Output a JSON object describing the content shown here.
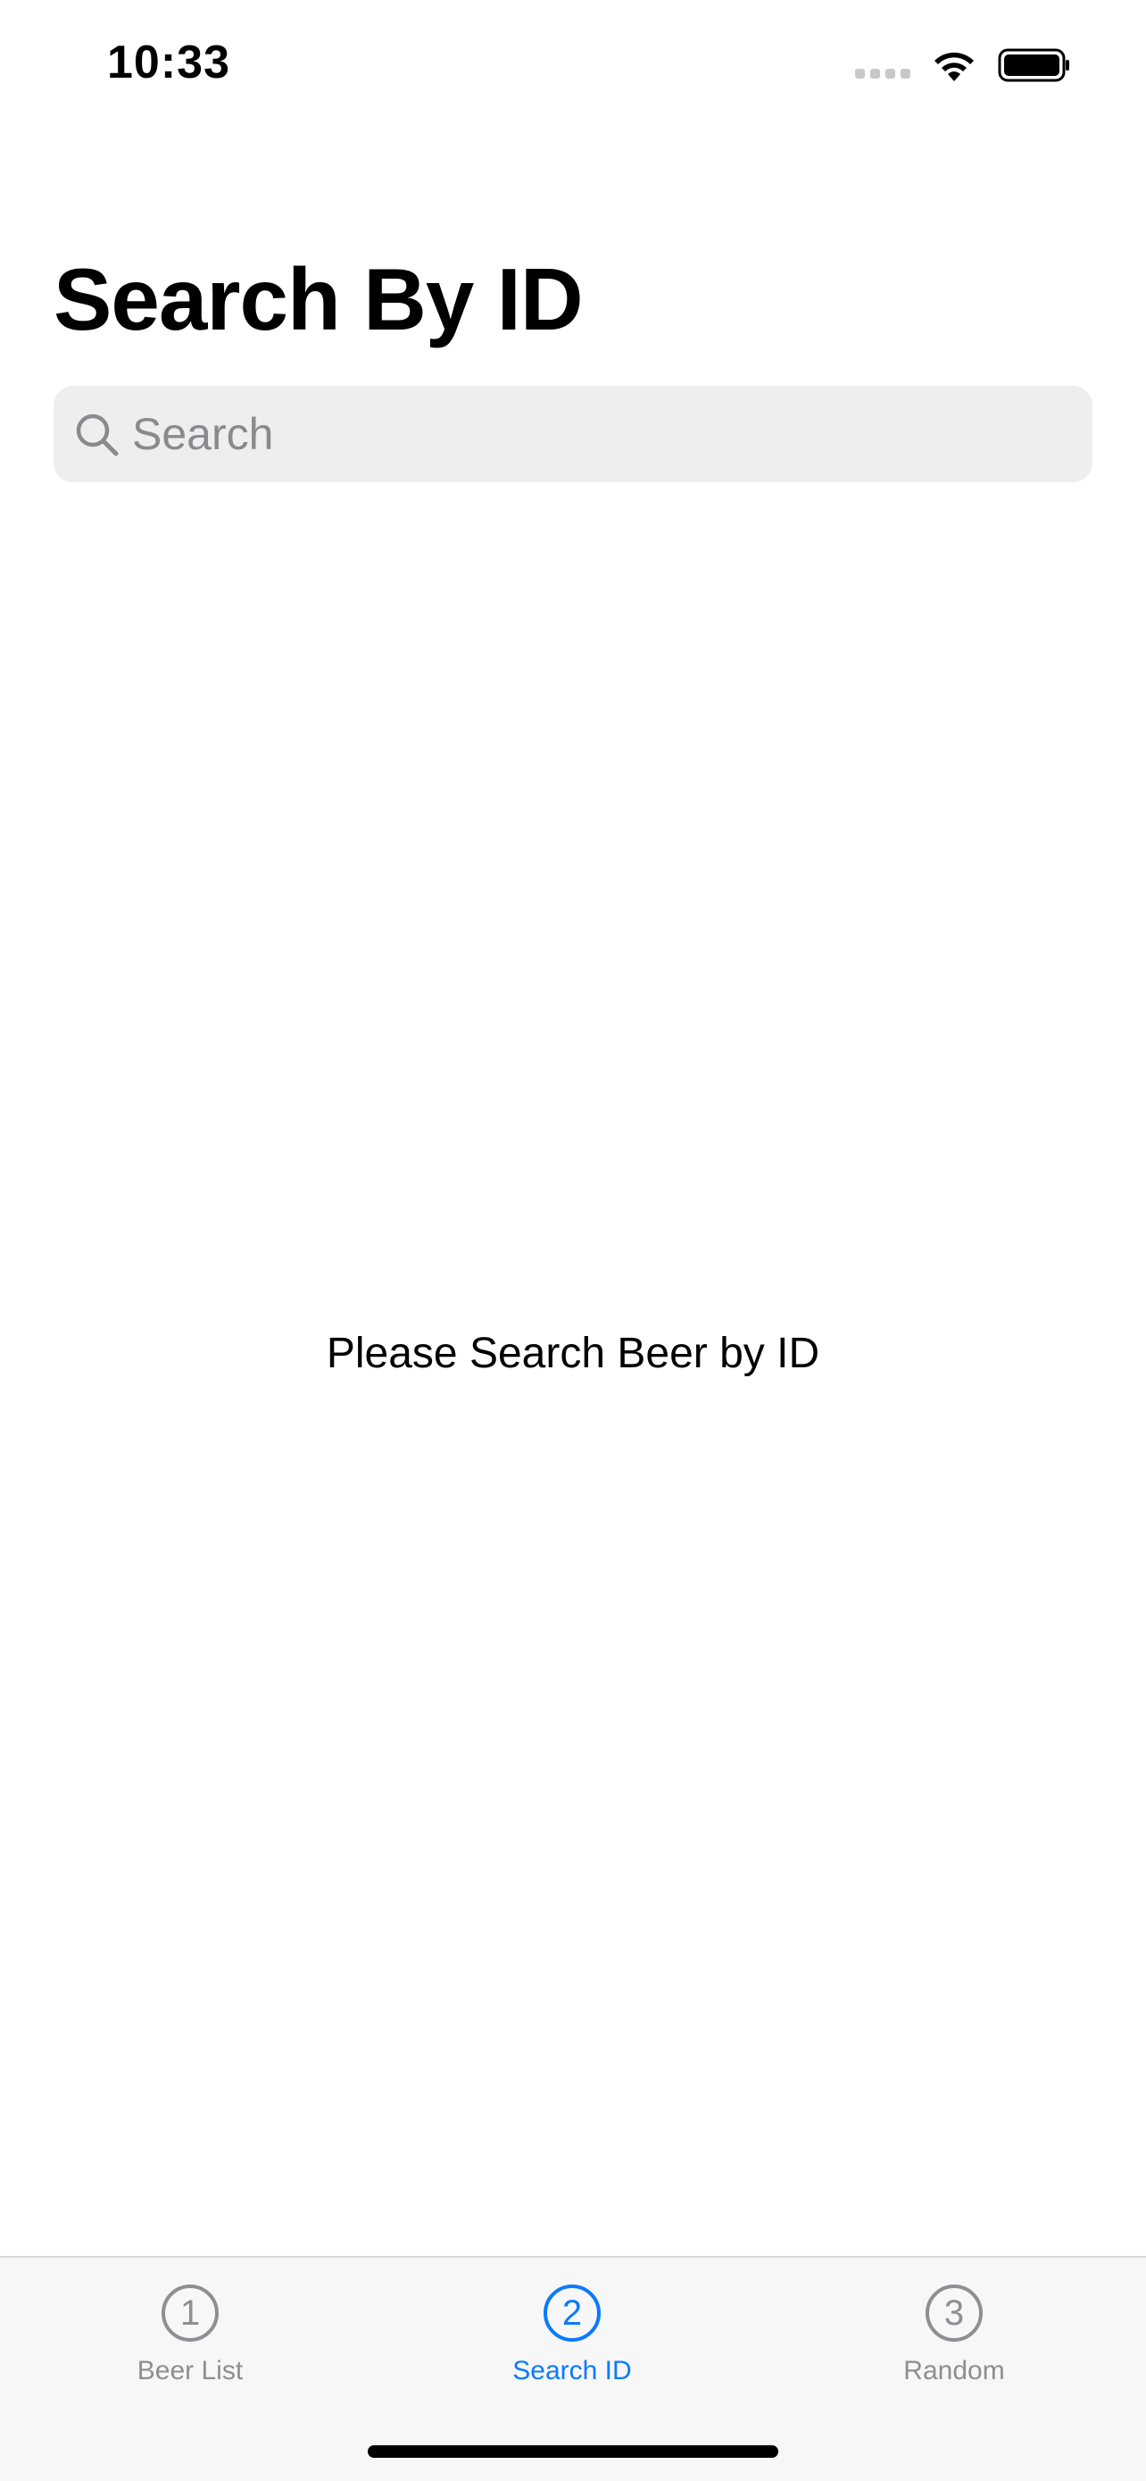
{
  "status_bar": {
    "time": "10:33",
    "wifi_icon": "wifi-icon",
    "battery_icon": "battery-icon",
    "signal_icon": "cellular-signal-icon"
  },
  "header": {
    "title": "Search By ID"
  },
  "search": {
    "placeholder": "Search",
    "value": "",
    "icon": "search-icon"
  },
  "main": {
    "empty_message": "Please Search Beer by ID"
  },
  "tab_bar": {
    "accent_color": "#0a7aff",
    "inactive_color": "#8e8e93",
    "tabs": [
      {
        "icon_text": "1",
        "label": "Beer List",
        "selected": false
      },
      {
        "icon_text": "2",
        "label": "Search ID",
        "selected": true
      },
      {
        "icon_text": "3",
        "label": "Random",
        "selected": false
      }
    ]
  }
}
